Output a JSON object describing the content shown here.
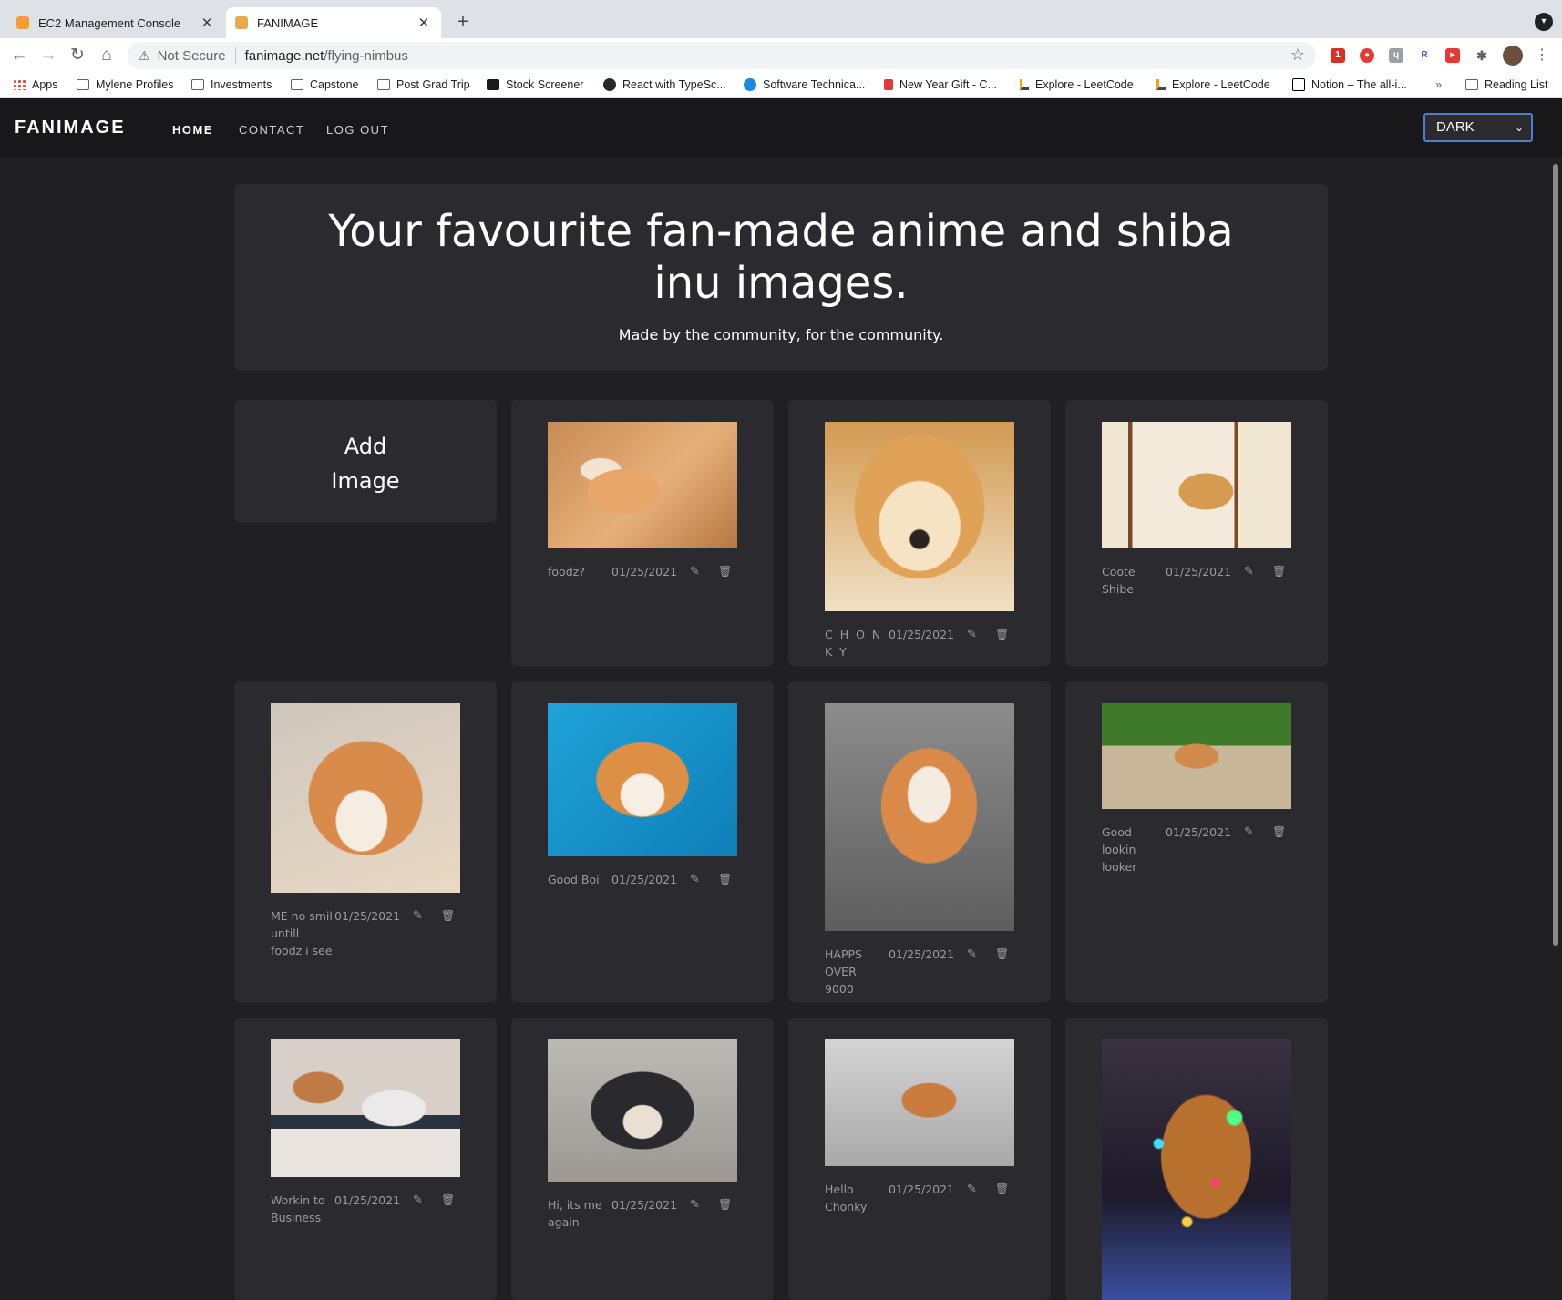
{
  "browser": {
    "tabs": [
      {
        "title": "EC2 Management Console",
        "favicon_color": "#f29d38",
        "active": false
      },
      {
        "title": "FANIMAGE",
        "favicon_color": "#e8a84c",
        "active": true
      }
    ],
    "address": {
      "security": "Not Secure",
      "host": "fanimage.net",
      "path": "/flying-nimbus"
    },
    "bookmarks": [
      {
        "label": "Apps",
        "icon": "apps-grid-icon"
      },
      {
        "label": "Mylene Profiles",
        "icon": "folder-icon"
      },
      {
        "label": "Investments",
        "icon": "folder-icon"
      },
      {
        "label": "Capstone",
        "icon": "folder-icon"
      },
      {
        "label": "Post Grad Trip",
        "icon": "folder-icon"
      },
      {
        "label": "Stock Screener",
        "icon": "inv-icon"
      },
      {
        "label": "React with TypeSc...",
        "icon": "github-icon"
      },
      {
        "label": "Software Technica...",
        "icon": "blue-s-icon"
      },
      {
        "label": "New Year Gift - C...",
        "icon": "red-bookmark-icon"
      },
      {
        "label": "Explore - LeetCode",
        "icon": "leetcode-icon"
      },
      {
        "label": "Explore - LeetCode",
        "icon": "leetcode-icon"
      },
      {
        "label": "Notion – The all-i...",
        "icon": "notion-icon"
      }
    ],
    "overflow": "»",
    "reading_list": "Reading List"
  },
  "app": {
    "brand": "FANIMAGE",
    "nav": [
      {
        "label": "HOME",
        "active": true
      },
      {
        "label": "CONTACT",
        "active": false
      },
      {
        "label": "LOG OUT",
        "active": false
      }
    ],
    "theme": {
      "selected": "DARK"
    }
  },
  "hero": {
    "title": "Your favourite fan-made anime and shiba inu images.",
    "subtitle": "Made by the community, for the community."
  },
  "add_card": {
    "line1": "Add",
    "line2": "Image"
  },
  "images": [
    {
      "caption": "foodz?",
      "date": "01/25/2021"
    },
    {
      "caption": "C H O N K Y",
      "date": "01/25/2021"
    },
    {
      "caption": "Coote Shibe",
      "date": "01/25/2021"
    },
    {
      "caption": "ME no smil untill foodz i see",
      "date": "01/25/2021"
    },
    {
      "caption": "Good Boi",
      "date": "01/25/2021"
    },
    {
      "caption": "HAPPS OVER 9000",
      "date": "01/25/2021"
    },
    {
      "caption": "Good lookin looker",
      "date": "01/25/2021"
    },
    {
      "caption": "Workin to Business",
      "date": "01/25/2021"
    },
    {
      "caption": "Hi, its me again",
      "date": "01/25/2021"
    },
    {
      "caption": "Hello Chonky",
      "date": "01/25/2021"
    },
    {
      "caption": "",
      "date": ""
    }
  ],
  "icons": {
    "edit": "edit-icon",
    "delete": "trash-icon"
  },
  "colors": {
    "background": "#202023",
    "card": "#2b2b2f",
    "navbar": "#18181a",
    "accent_focus": "#4c7fd1"
  }
}
